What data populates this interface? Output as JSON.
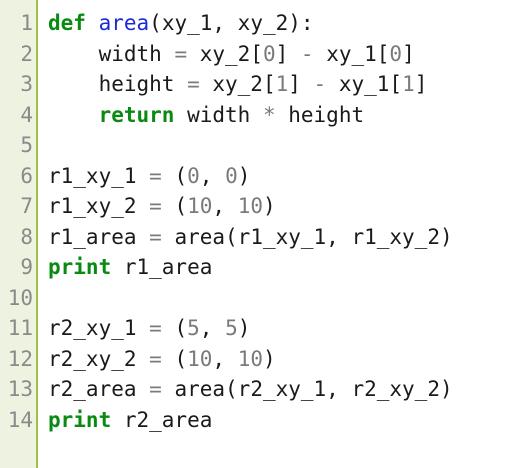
{
  "editor": {
    "colors": {
      "keyword": "#0a8a12",
      "function_name": "#1a2ad8",
      "operator": "#7a7a7a",
      "gutter_background": "#eef2e0",
      "gutter_border": "#9fc04a"
    },
    "lines": [
      {
        "num": "1",
        "tokens": [
          [
            "kw",
            "def"
          ],
          [
            "txt",
            " "
          ],
          [
            "fn",
            "area"
          ],
          [
            "txt",
            "(xy_1, xy_2):"
          ]
        ]
      },
      {
        "num": "2",
        "tokens": [
          [
            "txt",
            "    width "
          ],
          [
            "op",
            "="
          ],
          [
            "txt",
            " xy_2["
          ],
          [
            "num",
            "0"
          ],
          [
            "txt",
            "] "
          ],
          [
            "op",
            "-"
          ],
          [
            "txt",
            " xy_1["
          ],
          [
            "num",
            "0"
          ],
          [
            "txt",
            "]"
          ]
        ]
      },
      {
        "num": "3",
        "tokens": [
          [
            "txt",
            "    height "
          ],
          [
            "op",
            "="
          ],
          [
            "txt",
            " xy_2["
          ],
          [
            "num",
            "1"
          ],
          [
            "txt",
            "] "
          ],
          [
            "op",
            "-"
          ],
          [
            "txt",
            " xy_1["
          ],
          [
            "num",
            "1"
          ],
          [
            "txt",
            "]"
          ]
        ]
      },
      {
        "num": "4",
        "tokens": [
          [
            "txt",
            "    "
          ],
          [
            "kw",
            "return"
          ],
          [
            "txt",
            " width "
          ],
          [
            "op",
            "*"
          ],
          [
            "txt",
            " height"
          ]
        ]
      },
      {
        "num": "5",
        "tokens": []
      },
      {
        "num": "6",
        "tokens": [
          [
            "txt",
            "r1_xy_1 "
          ],
          [
            "op",
            "="
          ],
          [
            "txt",
            " ("
          ],
          [
            "num",
            "0"
          ],
          [
            "txt",
            ", "
          ],
          [
            "num",
            "0"
          ],
          [
            "txt",
            ")"
          ]
        ]
      },
      {
        "num": "7",
        "tokens": [
          [
            "txt",
            "r1_xy_2 "
          ],
          [
            "op",
            "="
          ],
          [
            "txt",
            " ("
          ],
          [
            "num",
            "10"
          ],
          [
            "txt",
            ", "
          ],
          [
            "num",
            "10"
          ],
          [
            "txt",
            ")"
          ]
        ]
      },
      {
        "num": "8",
        "tokens": [
          [
            "txt",
            "r1_area "
          ],
          [
            "op",
            "="
          ],
          [
            "txt",
            " area(r1_xy_1, r1_xy_2)"
          ]
        ]
      },
      {
        "num": "9",
        "tokens": [
          [
            "kw",
            "print"
          ],
          [
            "txt",
            " r1_area"
          ]
        ]
      },
      {
        "num": "10",
        "tokens": []
      },
      {
        "num": "11",
        "tokens": [
          [
            "txt",
            "r2_xy_1 "
          ],
          [
            "op",
            "="
          ],
          [
            "txt",
            " ("
          ],
          [
            "num",
            "5"
          ],
          [
            "txt",
            ", "
          ],
          [
            "num",
            "5"
          ],
          [
            "txt",
            ")"
          ]
        ]
      },
      {
        "num": "12",
        "tokens": [
          [
            "txt",
            "r2_xy_2 "
          ],
          [
            "op",
            "="
          ],
          [
            "txt",
            " ("
          ],
          [
            "num",
            "10"
          ],
          [
            "txt",
            ", "
          ],
          [
            "num",
            "10"
          ],
          [
            "txt",
            ")"
          ]
        ]
      },
      {
        "num": "13",
        "tokens": [
          [
            "txt",
            "r2_area "
          ],
          [
            "op",
            "="
          ],
          [
            "txt",
            " area(r2_xy_1, r2_xy_2)"
          ]
        ]
      },
      {
        "num": "14",
        "tokens": [
          [
            "kw",
            "print"
          ],
          [
            "txt",
            " r2_area"
          ]
        ]
      }
    ]
  }
}
